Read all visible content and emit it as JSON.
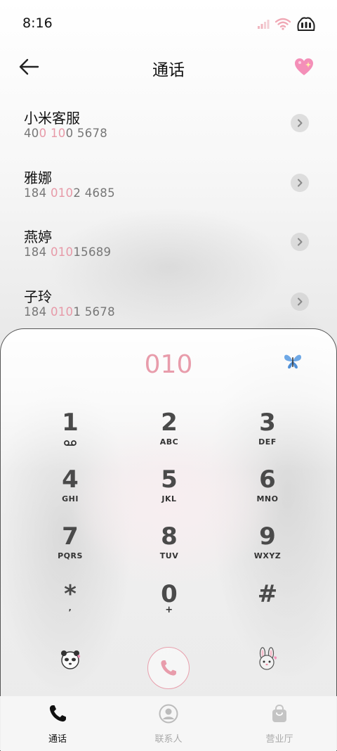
{
  "status_bar": {
    "time": "8:16"
  },
  "header": {
    "title": "通话"
  },
  "contacts": [
    {
      "name": "小米客服",
      "number_parts": [
        "40",
        "0 10",
        "0 5678"
      ]
    },
    {
      "name": "雅娜",
      "number_parts": [
        "184 ",
        "010",
        "2 4685"
      ]
    },
    {
      "name": "燕婷",
      "number_parts": [
        "184 ",
        "010",
        "15689"
      ]
    },
    {
      "name": "子玲",
      "number_parts": [
        "184 ",
        "010",
        "1 5678"
      ]
    }
  ],
  "dialpad": {
    "entered_number": "010",
    "keys": [
      {
        "digit": "1",
        "letters": ""
      },
      {
        "digit": "2",
        "letters": "ABC"
      },
      {
        "digit": "3",
        "letters": "DEF"
      },
      {
        "digit": "4",
        "letters": "GHI"
      },
      {
        "digit": "5",
        "letters": "JKL"
      },
      {
        "digit": "6",
        "letters": "MNO"
      },
      {
        "digit": "7",
        "letters": "PQRS"
      },
      {
        "digit": "8",
        "letters": "TUV"
      },
      {
        "digit": "9",
        "letters": "WXYZ"
      },
      {
        "digit": "*",
        "letters": ","
      },
      {
        "digit": "0",
        "letters": "+"
      },
      {
        "digit": "#",
        "letters": ""
      }
    ]
  },
  "tabs": [
    {
      "label": "通话",
      "icon": "phone-icon",
      "active": true
    },
    {
      "label": "联系人",
      "icon": "contact-icon",
      "active": false
    },
    {
      "label": "营业厅",
      "icon": "shopping-bag-icon",
      "active": false
    }
  ],
  "colors": {
    "accent_pink": "#e89cab",
    "text_dark": "#111111",
    "text_gray": "#777777"
  }
}
